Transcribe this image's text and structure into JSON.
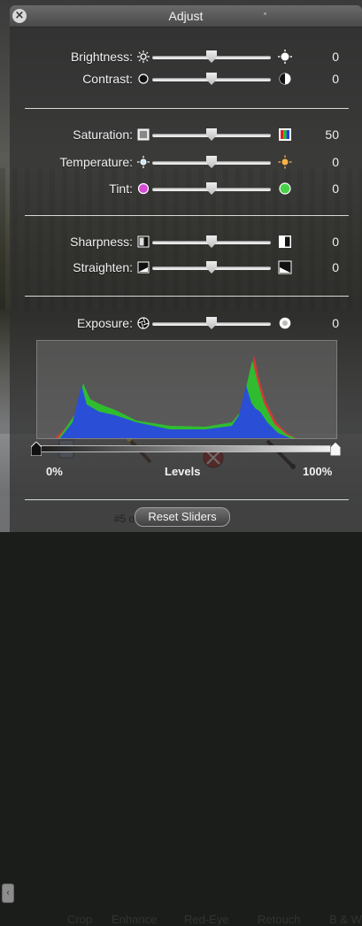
{
  "window": {
    "title": "Adjust"
  },
  "sections": [
    {
      "rows": [
        {
          "label": "Brightness:",
          "value": "0",
          "left_icon": "sun-small-icon",
          "right_icon": "sun-large-icon"
        },
        {
          "label": "Contrast:",
          "value": "0",
          "left_icon": "contrast-low-icon",
          "right_icon": "contrast-high-icon"
        }
      ]
    },
    {
      "rows": [
        {
          "label": "Saturation:",
          "value": "50",
          "left_icon": "saturation-low-icon",
          "right_icon": "saturation-high-icon"
        },
        {
          "label": "Temperature:",
          "value": "0",
          "left_icon": "cool-sun-icon",
          "right_icon": "warm-sun-icon"
        },
        {
          "label": "Tint:",
          "value": "0",
          "left_icon": "magenta-dot-icon",
          "right_icon": "green-dot-icon"
        }
      ]
    },
    {
      "rows": [
        {
          "label": "Sharpness:",
          "value": "0",
          "left_icon": "sharpness-low-icon",
          "right_icon": "sharpness-high-icon"
        },
        {
          "label": "Straighten:",
          "value": "0",
          "left_icon": "straighten-left-icon",
          "right_icon": "straighten-right-icon"
        }
      ]
    },
    {
      "rows": [
        {
          "label": "Exposure:",
          "value": "0",
          "left_icon": "aperture-icon",
          "right_icon": "exposure-bright-icon"
        }
      ]
    }
  ],
  "levels": {
    "label": "Levels",
    "min_label": "0%",
    "max_label": "100%"
  },
  "toolbar": {
    "items": [
      "Crop",
      "Enhance",
      "Red-Eye",
      "Retouch",
      "B & W"
    ]
  },
  "footer": {
    "partial_text": "#5 of",
    "reset_label": "Reset Sliders"
  },
  "colors": {
    "hud_bg": "#2d2d2d",
    "accent_green": "#2fbd2f",
    "accent_blue": "#2a4fd6",
    "accent_red": "#d43a3a"
  }
}
